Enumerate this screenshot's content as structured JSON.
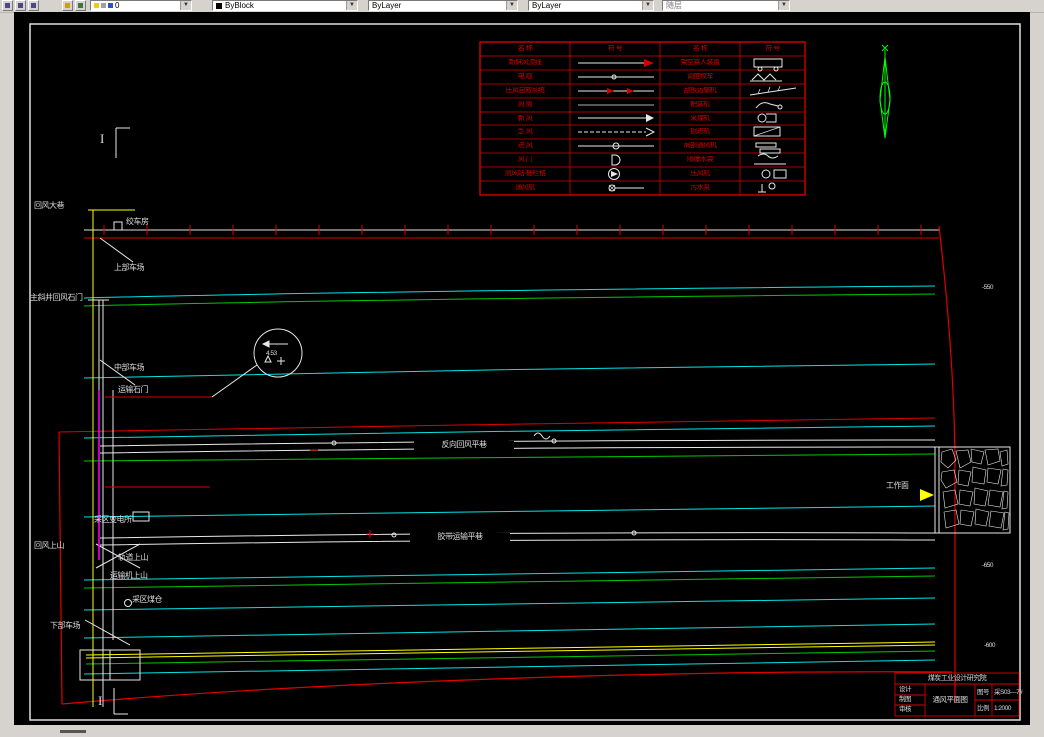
{
  "toolbar": {
    "layer_value": "0",
    "color_value": "ByBlock",
    "linetype_value": "ByLayer",
    "lineweight_value": "ByLayer",
    "plotstyle_value": "随层"
  },
  "legend": {
    "headers": [
      "名  称",
      "符  号",
      "名  称",
      "符  号"
    ],
    "rows": [
      {
        "left": "新鲜风流线",
        "left_symbol": "fresh-air-arrow",
        "right": "架空乘人装置",
        "right_symbol": "man-rider-device"
      },
      {
        "left": "电  缆",
        "left_symbol": "cable-line",
        "right": "调度绞车",
        "right_symbol": "dispatch-winch"
      },
      {
        "left": "压风自救系统",
        "left_symbol": "compressed-air-line",
        "right": "刮板运输机",
        "right_symbol": "scraper-conveyor"
      },
      {
        "left": "风  筒",
        "left_symbol": "air-duct-line",
        "right": "耙装机",
        "right_symbol": "rock-loader"
      },
      {
        "left": "新  风",
        "left_symbol": "intake-air-arrow",
        "right": "采煤机",
        "right_symbol": "shearer"
      },
      {
        "left": "乏  风",
        "left_symbol": "return-air-arrow",
        "right": "掘进机",
        "right_symbol": "roadheader"
      },
      {
        "left": "进  风",
        "left_symbol": "airflow-line",
        "right": "局部通风机",
        "right_symbol": "local-fan"
      },
      {
        "left": "风  门",
        "left_symbol": "air-door",
        "right": "隔爆水袋",
        "right_symbol": "water-bag-barrier"
      },
      {
        "left": "测风站·栅栏格",
        "left_symbol": "measuring-station",
        "right": "压风机",
        "right_symbol": "compressor"
      },
      {
        "left": "通风机",
        "left_symbol": "main-fan",
        "right": "污水泵",
        "right_symbol": "sewage-pump"
      }
    ]
  },
  "labels": {
    "huifeng_dajiang": "回风大巷",
    "jiaochefang": "绞车房",
    "shangbu_chechang": "上部车场",
    "zhuxiejing_shimen": "主斜井回风石门",
    "zhongbu_chechang": "中部车场",
    "yunshu_shimen": "运输石门",
    "caiqu_biandiansuo": "采区变电所",
    "huifeng_shangshan": "回风上山",
    "guidao_shangshan": "轨道上山",
    "yunshuji_shangshan": "运输机上山",
    "caiqu_meicang": "采区煤仓",
    "xiabu_chechang": "下部车场",
    "fanxiang_huifeng_pingxiang": "反向回风平巷",
    "jiaodai_yunshu_pingxiang": "胶带运输平巷",
    "gongzuomian": "工作面",
    "circle_value": "4.53",
    "elev_top": "-550",
    "elev_mid": "-650",
    "elev_bottom": "-600",
    "section_mark_top": "I",
    "section_mark_bottom": "I"
  },
  "titleblock": {
    "org": "煤炭工业设计研究院",
    "design_label": "设计",
    "draft_label": "制图",
    "check_label": "审核",
    "title": "通风平面图",
    "no_label": "图号",
    "no_value": "采S03—7#",
    "scale_label": "比例",
    "scale_value": "1:2000"
  },
  "colors": {
    "cyan": "#00e5e5",
    "green": "#00c800",
    "yellow": "#ffff00",
    "magenta": "#ff00ff",
    "red": "#e00000",
    "white": "#e8e8e8",
    "legend_red": "#d40000"
  }
}
